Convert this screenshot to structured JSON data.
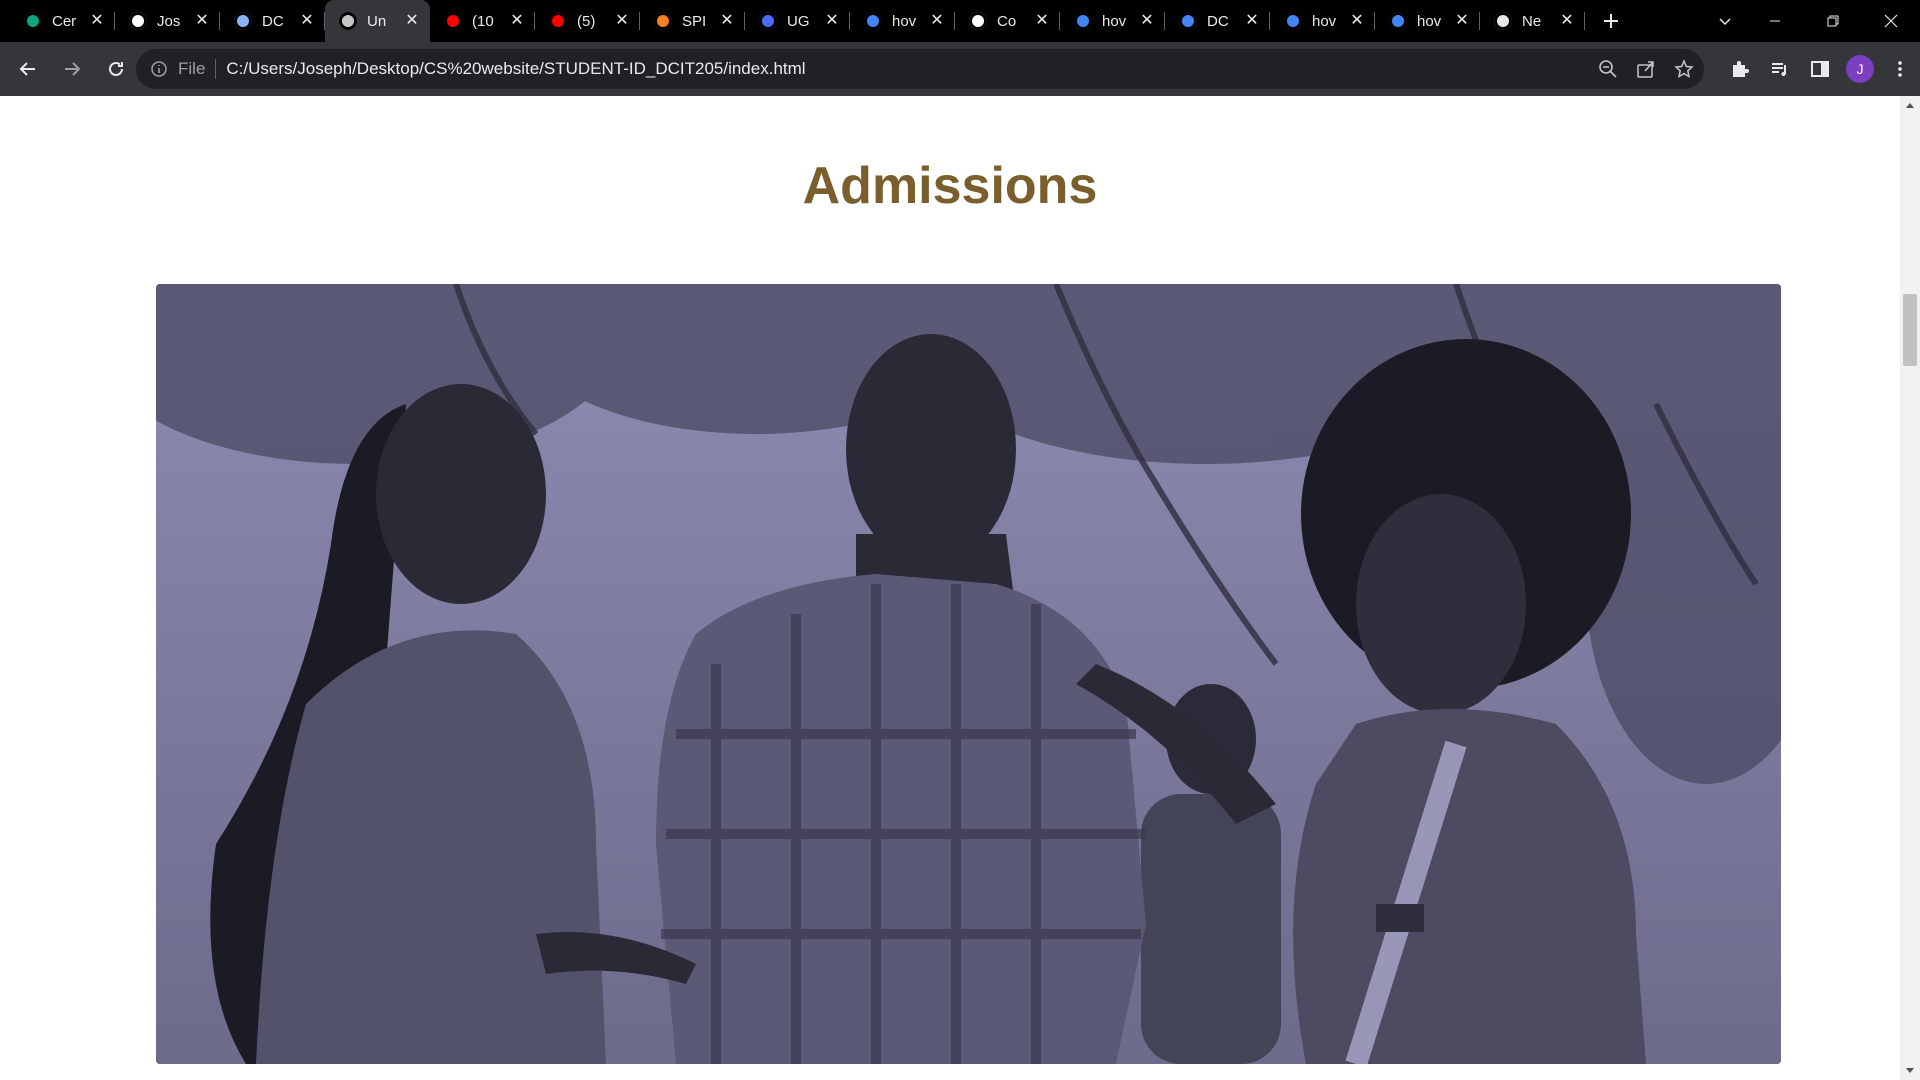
{
  "browser": {
    "tabs": [
      {
        "title": "Cer",
        "icon": "chatgpt-icon",
        "color": "#10a37f"
      },
      {
        "title": "Jos",
        "icon": "github-icon",
        "color": "#ffffff"
      },
      {
        "title": "DC",
        "icon": "globe-icon",
        "color": "#8ab4f8"
      },
      {
        "title": "Un",
        "icon": "page-icon",
        "color": "#c7c7c7",
        "active": true
      },
      {
        "title": "(10",
        "icon": "youtube-icon",
        "color": "#ff0000"
      },
      {
        "title": "(5)",
        "icon": "youtube-icon",
        "color": "#ff0000"
      },
      {
        "title": "SPI",
        "icon": "stackoverflow-icon",
        "color": "#f48024"
      },
      {
        "title": "UG",
        "icon": "arrow-icon",
        "color": "#4a6cf7"
      },
      {
        "title": "hov",
        "icon": "google-icon",
        "color": "#4285f4"
      },
      {
        "title": "Co",
        "icon": "github-icon",
        "color": "#ffffff"
      },
      {
        "title": "hov",
        "icon": "google-icon",
        "color": "#4285f4"
      },
      {
        "title": "DC",
        "icon": "docs-icon",
        "color": "#4285f4"
      },
      {
        "title": "hov",
        "icon": "google-icon",
        "color": "#4285f4"
      },
      {
        "title": "hov",
        "icon": "google-icon",
        "color": "#4285f4"
      },
      {
        "title": "Ne",
        "icon": "chrome-icon",
        "color": "#e8eaed"
      }
    ],
    "address": {
      "scheme_label": "File",
      "url": "C:/Users/Joseph/Desktop/CS%20website/STUDENT-ID_DCIT205/index.html"
    },
    "profile_initial": "J",
    "colors": {
      "tabstrip_bg": "#000000",
      "toolbar_bg": "#35363a",
      "omnibox_bg": "#202124",
      "profile": "#7b3fbf"
    }
  },
  "page": {
    "heading": "Admissions",
    "heading_color": "#7a5e2c",
    "hero_image": "students-photo",
    "hero_tint": "#5e5d78"
  }
}
